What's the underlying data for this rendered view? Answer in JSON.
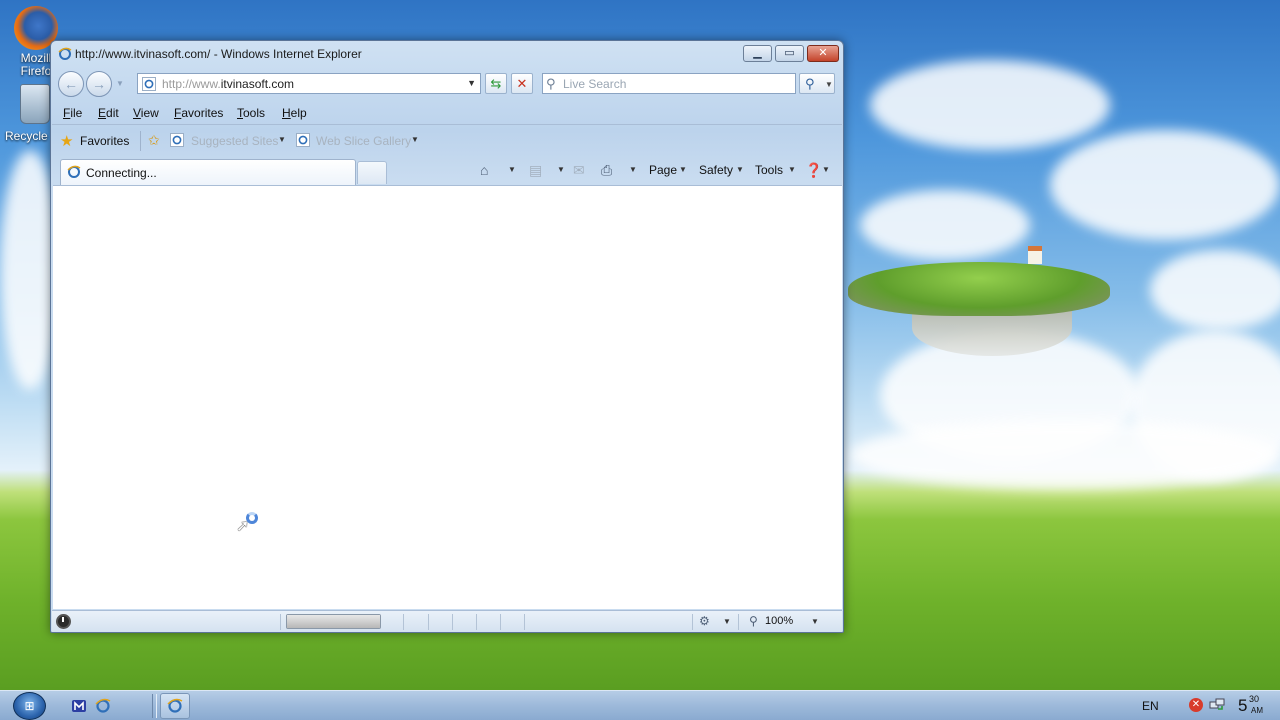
{
  "desktop": {
    "icons": [
      {
        "label": "Mozill\nFirefo",
        "icon": "firefox-icon"
      },
      {
        "label": "Recycle",
        "icon": "recycle-bin-icon"
      }
    ]
  },
  "window": {
    "title": "http://www.itvinasoft.com/ - Windows Internet Explorer",
    "address": {
      "prefix": "http://www.",
      "domain": "itvinasoft.com"
    },
    "search": {
      "placeholder": "Live Search",
      "value": ""
    },
    "menu": [
      {
        "label": "File",
        "accel": "F",
        "rest": "ile"
      },
      {
        "label": "Edit",
        "accel": "E",
        "rest": "dit"
      },
      {
        "label": "View",
        "accel": "V",
        "rest": "iew"
      },
      {
        "label": "Favorites",
        "accel": "F",
        "rest": "avorites"
      },
      {
        "label": "Tools",
        "accel": "T",
        "rest": "ools"
      },
      {
        "label": "Help",
        "accel": "H",
        "rest": "elp"
      }
    ],
    "favorites_bar": {
      "favorites_label": "Favorites",
      "items": [
        "Suggested Sites",
        "Web Slice Gallery"
      ]
    },
    "tab": {
      "label": "Connecting..."
    },
    "command_bar": {
      "page": "Page",
      "safety": "Safety",
      "tools": "Tools"
    },
    "status": {
      "zoom": "100%",
      "progress_fraction": 1.0
    }
  },
  "taskbar": {
    "language": "EN",
    "clock": {
      "hour": "5",
      "minute": "30",
      "ampm": "AM"
    }
  },
  "colors": {
    "title_close": "#c4432a",
    "fav_star": "#e6a514",
    "ie_blue": "#2f6fb8"
  }
}
